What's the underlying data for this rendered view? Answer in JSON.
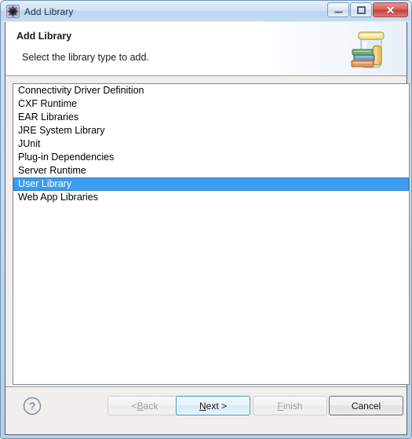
{
  "window": {
    "title": "Add Library",
    "icon": "eclipse-gear-icon",
    "controls": {
      "minimize": "Minimize",
      "maximize": "Maximize",
      "close": "Close",
      "close_glyph": "✕"
    }
  },
  "banner": {
    "title": "Add Library",
    "subtitle": "Select the library type to add.",
    "icon": "library-jar-books-icon"
  },
  "library_list": {
    "items": [
      {
        "label": "Connectivity Driver Definition",
        "selected": false
      },
      {
        "label": "CXF Runtime",
        "selected": false
      },
      {
        "label": "EAR Libraries",
        "selected": false
      },
      {
        "label": "JRE System Library",
        "selected": false
      },
      {
        "label": "JUnit",
        "selected": false
      },
      {
        "label": "Plug-in Dependencies",
        "selected": false
      },
      {
        "label": "Server Runtime",
        "selected": false
      },
      {
        "label": "User Library",
        "selected": true
      },
      {
        "label": "Web App Libraries",
        "selected": false
      }
    ],
    "selected_value": "User Library"
  },
  "footer": {
    "help": "?",
    "buttons": {
      "back": {
        "prefix": "< ",
        "mnemonic": "B",
        "rest": "ack",
        "enabled": false
      },
      "next": {
        "prefix": "",
        "mnemonic": "N",
        "rest": "ext >",
        "enabled": true,
        "is_default": true
      },
      "finish": {
        "prefix": "",
        "mnemonic": "F",
        "rest": "inish",
        "enabled": false
      },
      "cancel": {
        "prefix": "",
        "mnemonic": "",
        "rest": "Cancel",
        "enabled": true
      }
    }
  },
  "colors": {
    "title_bar": "#c6dcf1",
    "frame": "#b7cfe6",
    "selection": "#3c9cf0",
    "close_button": "#c43f38",
    "dialog_bg": "#f0efee",
    "list_bg": "#ffffff",
    "default_button_border": "#3c93c8"
  }
}
